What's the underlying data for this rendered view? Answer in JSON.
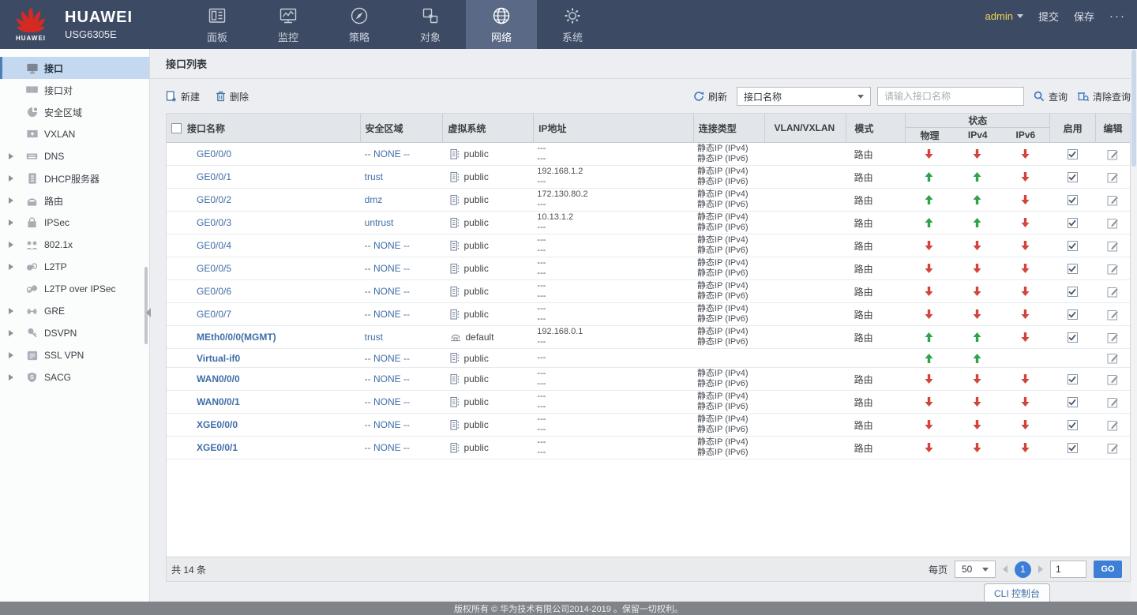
{
  "colors": {
    "topbar": "#3D4A63",
    "active_tab": "#5A6A86",
    "link": "#3F6EA8",
    "up": "#2EA24C",
    "down": "#D0453C",
    "go": "#3D7FD6",
    "admin": "#EFD54F"
  },
  "header": {
    "brand": {
      "logo_text": "HUAWEI",
      "name": "HUAWEI",
      "model": "USG6305E"
    },
    "nav": [
      {
        "name": "dashboard",
        "label": "面板",
        "icon": "dashboard",
        "active": false
      },
      {
        "name": "monitor",
        "label": "监控",
        "icon": "monitor",
        "active": false
      },
      {
        "name": "policy",
        "label": "策略",
        "icon": "policy",
        "active": false
      },
      {
        "name": "object",
        "label": "对象",
        "icon": "object",
        "active": false
      },
      {
        "name": "network",
        "label": "网络",
        "icon": "network",
        "active": true
      },
      {
        "name": "system",
        "label": "系统",
        "icon": "system",
        "active": false
      }
    ],
    "user": {
      "name": "admin"
    },
    "actions": {
      "submit": "提交",
      "save": "保存",
      "more": "···"
    }
  },
  "sidebar": {
    "items": [
      {
        "name": "interface",
        "label": "接口",
        "icon": "interface",
        "expandable": false,
        "selected": true
      },
      {
        "name": "interface-pair",
        "label": "接口对",
        "icon": "interface-pair",
        "expandable": false,
        "selected": false
      },
      {
        "name": "security-zone",
        "label": "安全区域",
        "icon": "security-zone",
        "expandable": false,
        "selected": false
      },
      {
        "name": "vxlan",
        "label": "VXLAN",
        "icon": "vxlan",
        "expandable": false,
        "selected": false
      },
      {
        "name": "dns",
        "label": "DNS",
        "icon": "dns",
        "expandable": true,
        "selected": false
      },
      {
        "name": "dhcp-server",
        "label": "DHCP服务器",
        "icon": "dhcp-server",
        "expandable": true,
        "selected": false
      },
      {
        "name": "route",
        "label": "路由",
        "icon": "route",
        "expandable": true,
        "selected": false
      },
      {
        "name": "ipsec",
        "label": "IPSec",
        "icon": "ipsec",
        "expandable": true,
        "selected": false
      },
      {
        "name": "dot1x",
        "label": "802.1x",
        "icon": "dot1x",
        "expandable": true,
        "selected": false
      },
      {
        "name": "l2tp",
        "label": "L2TP",
        "icon": "l2tp",
        "expandable": true,
        "selected": false
      },
      {
        "name": "l2tp-over-ipsec",
        "label": "L2TP over IPSec",
        "icon": "l2tp-ipsec",
        "expandable": false,
        "selected": false
      },
      {
        "name": "gre",
        "label": "GRE",
        "icon": "gre",
        "expandable": true,
        "selected": false
      },
      {
        "name": "dsvpn",
        "label": "DSVPN",
        "icon": "dsvpn",
        "expandable": true,
        "selected": false
      },
      {
        "name": "ssl-vpn",
        "label": "SSL VPN",
        "icon": "ssl-vpn",
        "expandable": true,
        "selected": false
      },
      {
        "name": "sacg",
        "label": "SACG",
        "icon": "sacg",
        "expandable": true,
        "selected": false
      }
    ]
  },
  "page": {
    "title": "接口列表"
  },
  "toolbar": {
    "new": "新建",
    "delete": "删除",
    "refresh": "刷新",
    "filter_field": "接口名称",
    "search_placeholder": "请输入接口名称",
    "query": "查询",
    "clear_query": "清除查询"
  },
  "table": {
    "columns": [
      {
        "key": "name",
        "label": "接口名称"
      },
      {
        "key": "zone",
        "label": "安全区域"
      },
      {
        "key": "vsys",
        "label": "虚拟系统"
      },
      {
        "key": "ip",
        "label": "IP地址"
      },
      {
        "key": "conn",
        "label": "连接类型"
      },
      {
        "key": "vlan",
        "label": "VLAN/VXLAN"
      },
      {
        "key": "mode",
        "label": "模式"
      },
      {
        "key": "status",
        "label": "状态",
        "sub": [
          "物理",
          "IPv4",
          "IPv6"
        ]
      },
      {
        "key": "enable",
        "label": "启用"
      },
      {
        "key": "edit",
        "label": "编辑"
      }
    ],
    "rows": [
      {
        "name": "GE0/0/0",
        "bold": false,
        "zone": "-- NONE --",
        "vsys": "public",
        "vsys_icon": "vsys-public",
        "ip": [
          "---",
          "---"
        ],
        "conn": [
          "静态IP (IPv4)",
          "静态IP (IPv6)"
        ],
        "vlan": "",
        "mode": "路由",
        "phy": "down",
        "ipv4": "down",
        "ipv6": "down",
        "enabled": true,
        "editable": true
      },
      {
        "name": "GE0/0/1",
        "bold": false,
        "zone": "trust",
        "vsys": "public",
        "vsys_icon": "vsys-public",
        "ip": [
          "192.168.1.2",
          "---"
        ],
        "conn": [
          "静态IP (IPv4)",
          "静态IP (IPv6)"
        ],
        "vlan": "",
        "mode": "路由",
        "phy": "up",
        "ipv4": "up",
        "ipv6": "down",
        "enabled": true,
        "editable": true
      },
      {
        "name": "GE0/0/2",
        "bold": false,
        "zone": "dmz",
        "vsys": "public",
        "vsys_icon": "vsys-public",
        "ip": [
          "172.130.80.2",
          "---"
        ],
        "conn": [
          "静态IP (IPv4)",
          "静态IP (IPv6)"
        ],
        "vlan": "",
        "mode": "路由",
        "phy": "up",
        "ipv4": "up",
        "ipv6": "down",
        "enabled": true,
        "editable": true
      },
      {
        "name": "GE0/0/3",
        "bold": false,
        "zone": "untrust",
        "vsys": "public",
        "vsys_icon": "vsys-public",
        "ip": [
          "10.13.1.2",
          "---"
        ],
        "conn": [
          "静态IP (IPv4)",
          "静态IP (IPv6)"
        ],
        "vlan": "",
        "mode": "路由",
        "phy": "up",
        "ipv4": "up",
        "ipv6": "down",
        "enabled": true,
        "editable": true
      },
      {
        "name": "GE0/0/4",
        "bold": false,
        "zone": "-- NONE --",
        "vsys": "public",
        "vsys_icon": "vsys-public",
        "ip": [
          "---",
          "---"
        ],
        "conn": [
          "静态IP (IPv4)",
          "静态IP (IPv6)"
        ],
        "vlan": "",
        "mode": "路由",
        "phy": "down",
        "ipv4": "down",
        "ipv6": "down",
        "enabled": true,
        "editable": true
      },
      {
        "name": "GE0/0/5",
        "bold": false,
        "zone": "-- NONE --",
        "vsys": "public",
        "vsys_icon": "vsys-public",
        "ip": [
          "---",
          "---"
        ],
        "conn": [
          "静态IP (IPv4)",
          "静态IP (IPv6)"
        ],
        "vlan": "",
        "mode": "路由",
        "phy": "down",
        "ipv4": "down",
        "ipv6": "down",
        "enabled": true,
        "editable": true
      },
      {
        "name": "GE0/0/6",
        "bold": false,
        "zone": "-- NONE --",
        "vsys": "public",
        "vsys_icon": "vsys-public",
        "ip": [
          "---",
          "---"
        ],
        "conn": [
          "静态IP (IPv4)",
          "静态IP (IPv6)"
        ],
        "vlan": "",
        "mode": "路由",
        "phy": "down",
        "ipv4": "down",
        "ipv6": "down",
        "enabled": true,
        "editable": true
      },
      {
        "name": "GE0/0/7",
        "bold": false,
        "zone": "-- NONE --",
        "vsys": "public",
        "vsys_icon": "vsys-public",
        "ip": [
          "---",
          "---"
        ],
        "conn": [
          "静态IP (IPv4)",
          "静态IP (IPv6)"
        ],
        "vlan": "",
        "mode": "路由",
        "phy": "down",
        "ipv4": "down",
        "ipv6": "down",
        "enabled": true,
        "editable": true
      },
      {
        "name": "MEth0/0/0(MGMT)",
        "bold": true,
        "zone": "trust",
        "vsys": "default",
        "vsys_icon": "vsys-default",
        "ip": [
          "192.168.0.1",
          "---"
        ],
        "conn": [
          "静态IP (IPv4)",
          "静态IP (IPv6)"
        ],
        "vlan": "",
        "mode": "路由",
        "phy": "up",
        "ipv4": "up",
        "ipv6": "down",
        "enabled": true,
        "editable": true
      },
      {
        "name": "Virtual-if0",
        "bold": true,
        "zone": "-- NONE --",
        "vsys": "public",
        "vsys_icon": "vsys-public",
        "ip": [
          "---"
        ],
        "conn": [],
        "vlan": "",
        "mode": "",
        "phy": "up",
        "ipv4": "up",
        "ipv6": "none",
        "enabled": false,
        "editable": true
      },
      {
        "name": "WAN0/0/0",
        "bold": true,
        "zone": "-- NONE --",
        "vsys": "public",
        "vsys_icon": "vsys-public",
        "ip": [
          "---",
          "---"
        ],
        "conn": [
          "静态IP (IPv4)",
          "静态IP (IPv6)"
        ],
        "vlan": "",
        "mode": "路由",
        "phy": "down",
        "ipv4": "down",
        "ipv6": "down",
        "enabled": true,
        "editable": true
      },
      {
        "name": "WAN0/0/1",
        "bold": true,
        "zone": "-- NONE --",
        "vsys": "public",
        "vsys_icon": "vsys-public",
        "ip": [
          "---",
          "---"
        ],
        "conn": [
          "静态IP (IPv4)",
          "静态IP (IPv6)"
        ],
        "vlan": "",
        "mode": "路由",
        "phy": "down",
        "ipv4": "down",
        "ipv6": "down",
        "enabled": true,
        "editable": true
      },
      {
        "name": "XGE0/0/0",
        "bold": true,
        "zone": "-- NONE --",
        "vsys": "public",
        "vsys_icon": "vsys-public",
        "ip": [
          "---",
          "---"
        ],
        "conn": [
          "静态IP (IPv4)",
          "静态IP (IPv6)"
        ],
        "vlan": "",
        "mode": "路由",
        "phy": "down",
        "ipv4": "down",
        "ipv6": "down",
        "enabled": true,
        "editable": true
      },
      {
        "name": "XGE0/0/1",
        "bold": true,
        "zone": "-- NONE --",
        "vsys": "public",
        "vsys_icon": "vsys-public",
        "ip": [
          "---",
          "---"
        ],
        "conn": [
          "静态IP (IPv4)",
          "静态IP (IPv6)"
        ],
        "vlan": "",
        "mode": "路由",
        "phy": "down",
        "ipv4": "down",
        "ipv6": "down",
        "enabled": true,
        "editable": true
      }
    ]
  },
  "pagination": {
    "total": "共 14 条",
    "per_page_label": "每页",
    "per_page": "50",
    "current_page": "1",
    "goto_value": "1",
    "go": "GO"
  },
  "cli_button": "CLI 控制台",
  "footer": {
    "copyright": "版权所有 © 华为技术有限公司2014-2019 。保留一切权利。"
  }
}
